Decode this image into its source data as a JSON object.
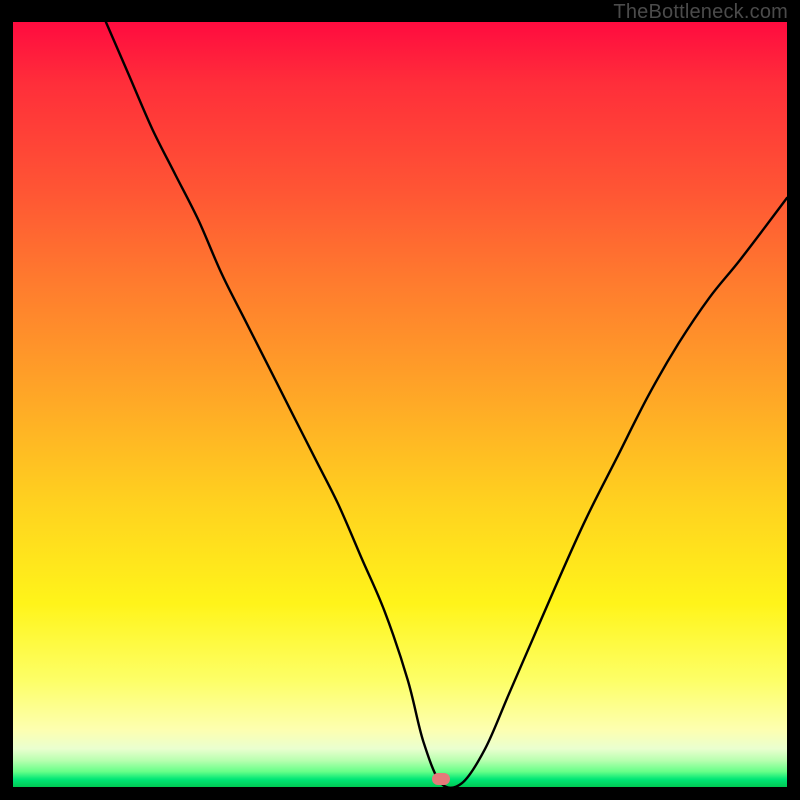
{
  "watermark": {
    "text": "TheBottleneck.com"
  },
  "marker": {
    "x_pct": 55.3,
    "y_pct": 99.0,
    "color": "#e47a7a"
  },
  "chart_data": {
    "type": "line",
    "title": "",
    "xlabel": "",
    "ylabel": "",
    "xlim": [
      0,
      100
    ],
    "ylim": [
      0,
      100
    ],
    "grid": false,
    "legend": false,
    "annotations": [
      {
        "text": "TheBottleneck.com",
        "position": "top-right"
      }
    ],
    "series": [
      {
        "name": "curve",
        "x": [
          12,
          15,
          18,
          21,
          24,
          27,
          30,
          33,
          36,
          39,
          42,
          45,
          48,
          51,
          53,
          55.3,
          58,
          61,
          64,
          67,
          70,
          74,
          78,
          82,
          86,
          90,
          94,
          100
        ],
        "values": [
          100,
          93,
          86,
          80,
          74,
          67,
          61,
          55,
          49,
          43,
          37,
          30,
          23,
          14,
          6,
          0.5,
          0.5,
          5,
          12,
          19,
          26,
          35,
          43,
          51,
          58,
          64,
          69,
          77
        ]
      }
    ],
    "background_gradient_stops": [
      {
        "pos": 0,
        "color": "#ff0b3f"
      },
      {
        "pos": 0.22,
        "color": "#ff5534"
      },
      {
        "pos": 0.48,
        "color": "#ffa427"
      },
      {
        "pos": 0.76,
        "color": "#fff41a"
      },
      {
        "pos": 0.93,
        "color": "#fdffb0"
      },
      {
        "pos": 0.98,
        "color": "#66ff88"
      },
      {
        "pos": 1.0,
        "color": "#00c853"
      }
    ]
  }
}
